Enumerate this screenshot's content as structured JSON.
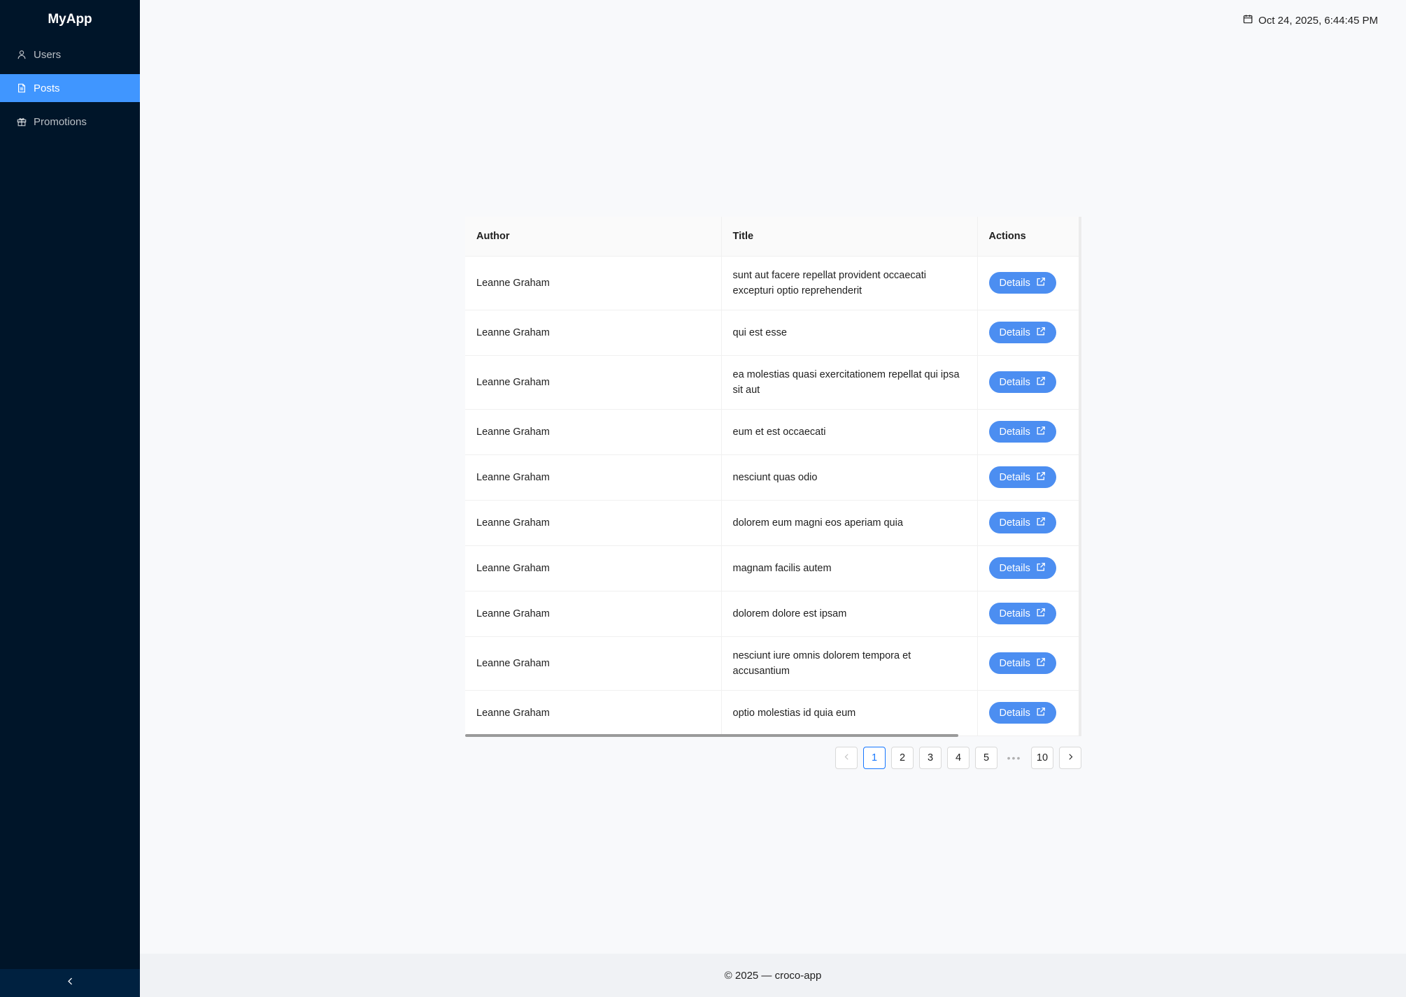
{
  "app": {
    "name": "MyApp"
  },
  "sidebar": {
    "items": [
      {
        "label": "Users",
        "icon": "user-icon",
        "active": false
      },
      {
        "label": "Posts",
        "icon": "file-icon",
        "active": true
      },
      {
        "label": "Promotions",
        "icon": "gift-icon",
        "active": false
      }
    ],
    "collapse_icon": "chevron-left-icon"
  },
  "header": {
    "datetime": "Oct 24, 2025, 6:44:45 PM",
    "icon": "calendar-icon"
  },
  "table": {
    "columns": [
      "Author",
      "Title",
      "Actions"
    ],
    "action_label": "Details",
    "action_icon": "external-link-icon",
    "rows": [
      {
        "author": "Leanne Graham",
        "title": "sunt aut facere repellat provident occaecati excepturi optio reprehenderit"
      },
      {
        "author": "Leanne Graham",
        "title": "qui est esse"
      },
      {
        "author": "Leanne Graham",
        "title": "ea molestias quasi exercitationem repellat qui ipsa sit aut"
      },
      {
        "author": "Leanne Graham",
        "title": "eum et est occaecati"
      },
      {
        "author": "Leanne Graham",
        "title": "nesciunt quas odio"
      },
      {
        "author": "Leanne Graham",
        "title": "dolorem eum magni eos aperiam quia"
      },
      {
        "author": "Leanne Graham",
        "title": "magnam facilis autem"
      },
      {
        "author": "Leanne Graham",
        "title": "dolorem dolore est ipsam"
      },
      {
        "author": "Leanne Graham",
        "title": "nesciunt iure omnis dolorem tempora et accusantium"
      },
      {
        "author": "Leanne Graham",
        "title": "optio molestias id quia eum"
      }
    ]
  },
  "pagination": {
    "pages": [
      "1",
      "2",
      "3",
      "4",
      "5"
    ],
    "ellipsis": "•••",
    "last_page": "10",
    "current": "1"
  },
  "footer": {
    "text": "© 2025 — croco-app"
  },
  "colors": {
    "sidebar_bg": "#001529",
    "accent": "#4096ff",
    "button": "#4c8ef1"
  }
}
